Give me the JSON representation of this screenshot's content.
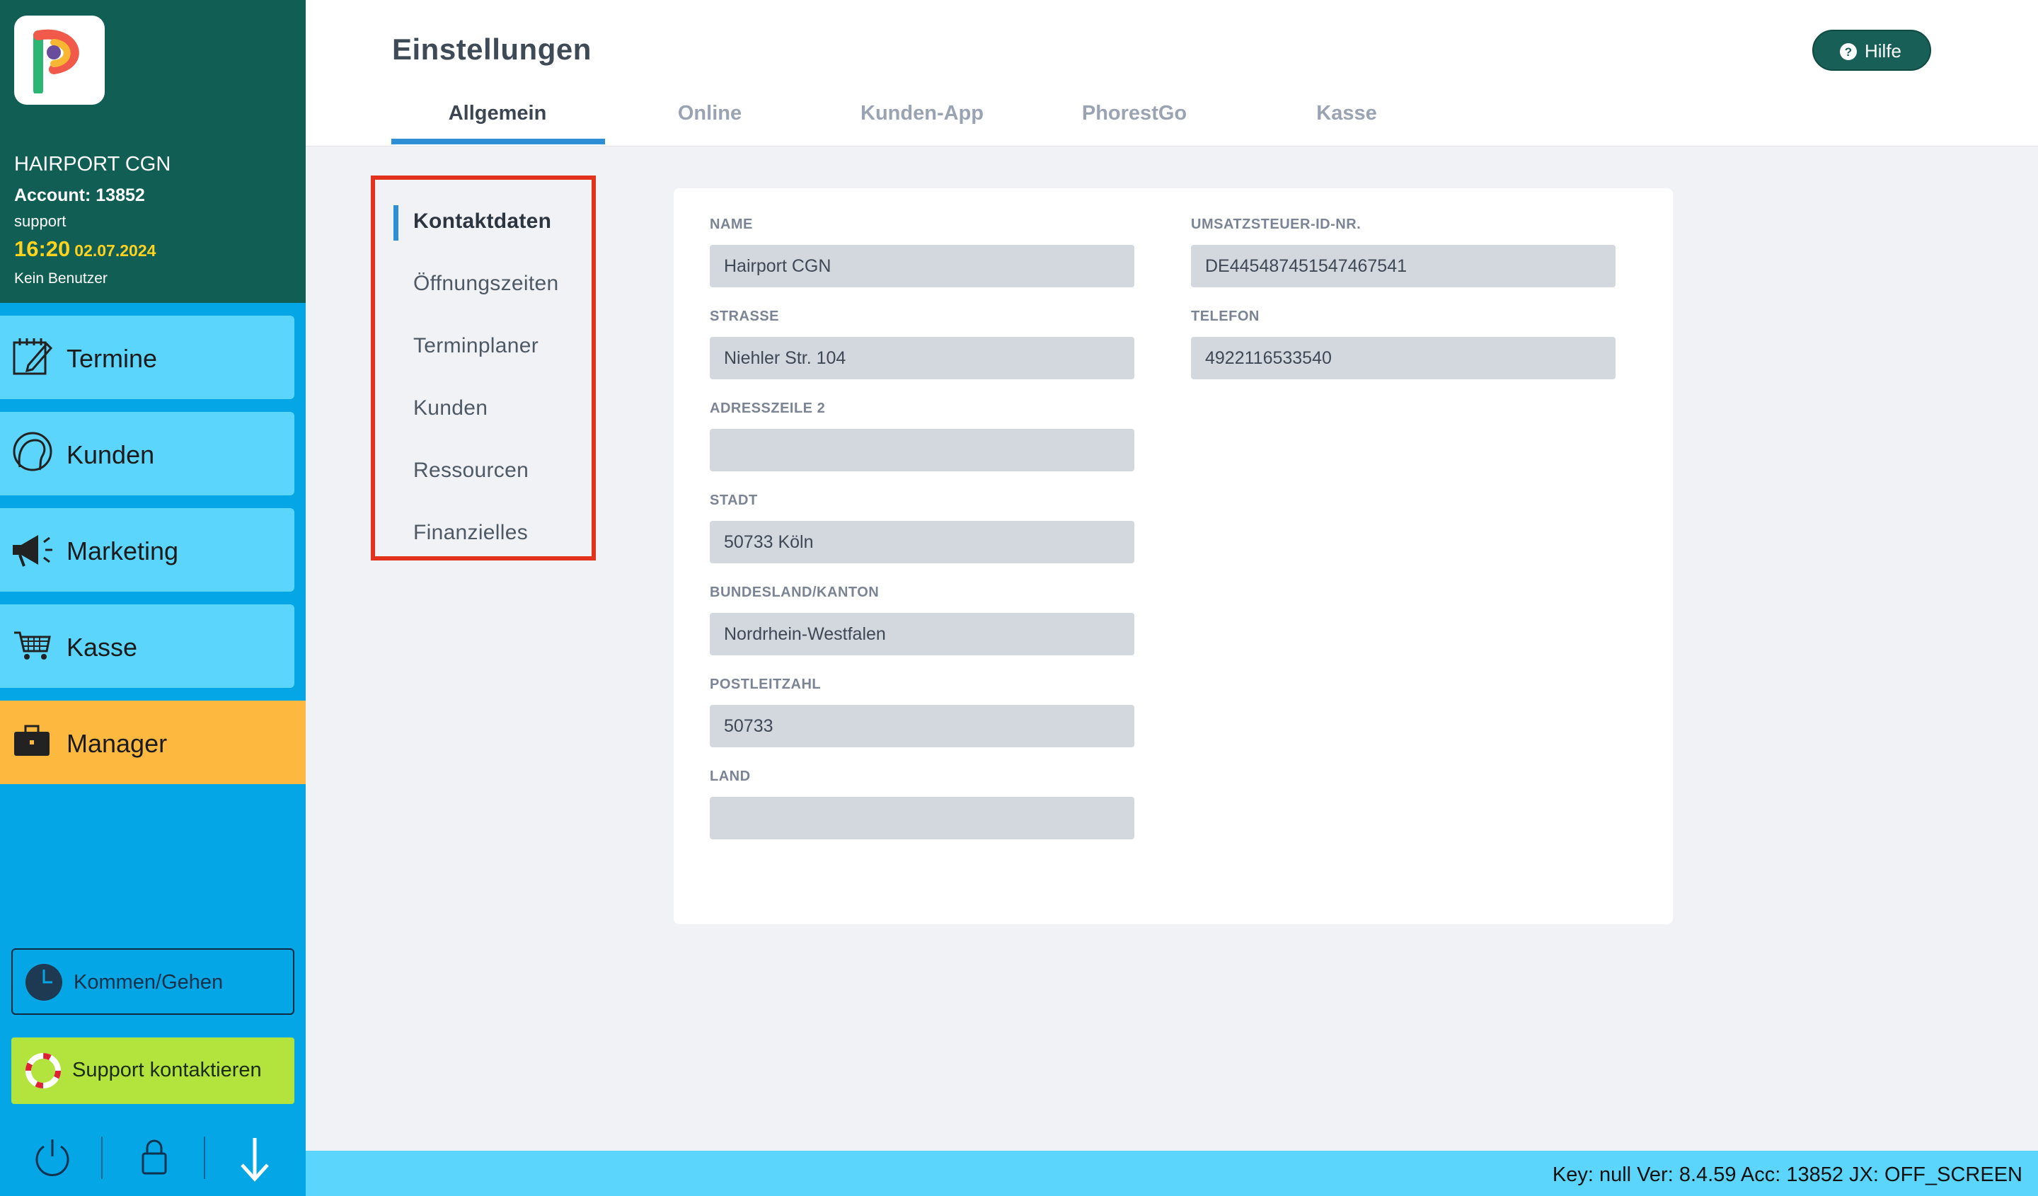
{
  "sidebar": {
    "account": {
      "name": "HAIRPORT CGN",
      "account_line": "Account: 13852",
      "user": "support",
      "time": "16:20",
      "date": "02.07.2024",
      "no_user": "Kein Benutzer"
    },
    "nav": [
      {
        "label": "Termine",
        "icon": "calendar-edit-icon"
      },
      {
        "label": "Kunden",
        "icon": "customer-head-icon"
      },
      {
        "label": "Marketing",
        "icon": "megaphone-icon"
      },
      {
        "label": "Kasse",
        "icon": "shopping-cart-icon"
      },
      {
        "label": "Manager",
        "icon": "briefcase-icon",
        "active": true
      }
    ],
    "clock_button": "Kommen/Gehen",
    "support_button": "Support kontaktieren",
    "bottom_icons": [
      "power-icon",
      "lock-icon",
      "arrow-down-icon"
    ]
  },
  "header": {
    "title": "Einstellungen",
    "help_label": "Hilfe",
    "tabs": [
      {
        "label": "Allgemein",
        "active": true
      },
      {
        "label": "Online"
      },
      {
        "label": "Kunden-App"
      },
      {
        "label": "PhorestGo"
      },
      {
        "label": "Kasse"
      }
    ]
  },
  "subnav": {
    "items": [
      {
        "label": "Kontaktdaten",
        "active": true
      },
      {
        "label": "Öffnungszeiten"
      },
      {
        "label": "Terminplaner"
      },
      {
        "label": "Kunden"
      },
      {
        "label": "Ressourcen"
      },
      {
        "label": "Finanzielles"
      }
    ]
  },
  "form": {
    "left": [
      {
        "label": "NAME",
        "value": "Hairport CGN"
      },
      {
        "label": "STRASSE",
        "value": "Niehler Str. 104"
      },
      {
        "label": "ADRESSZEILE 2",
        "value": ""
      },
      {
        "label": "STADT",
        "value": "50733 Köln"
      },
      {
        "label": "BUNDESLAND/KANTON",
        "value": "Nordrhein-Westfalen"
      },
      {
        "label": "POSTLEITZAHL",
        "value": "50733"
      },
      {
        "label": "LAND",
        "value": ""
      }
    ],
    "right": [
      {
        "label": "UMSATZSTEUER-ID-NR.",
        "value": "DE445487451547467541"
      },
      {
        "label": "TELEFON",
        "value": "4922116533540"
      }
    ]
  },
  "statusbar": {
    "text": "Key: null Ver: 8.4.59 Acc: 13852  JX: OFF_SCREEN"
  },
  "colors": {
    "sidebar_top": "#115e55",
    "sidebar": "#04a6e6",
    "nav_item": "#5bd5fb",
    "nav_active": "#fdb83f",
    "support": "#b3e43e",
    "accent": "#2f8fd6",
    "highlight_box": "#e2321b"
  }
}
